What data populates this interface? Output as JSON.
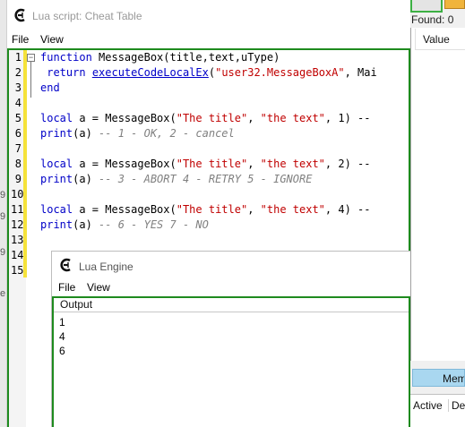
{
  "background": {
    "left_tags": [
      "9",
      "9",
      "9",
      "e"
    ],
    "found_label": "Found: 0",
    "value_header": "Value",
    "memory_view_button": "Mem",
    "cheat_columns": [
      "Active",
      "Des"
    ]
  },
  "lua_window": {
    "title": "Lua script: Cheat Table",
    "menu": [
      "File",
      "View"
    ],
    "line_numbers": [
      "1",
      "2",
      "3",
      "4",
      "5",
      "6",
      "7",
      "8",
      "9",
      "10",
      "11",
      "12",
      "13",
      "14",
      "15"
    ],
    "code": {
      "l1_kw": "function",
      "l1_rest": " MessageBox(title,text,uType)",
      "l2_kw": " return",
      "l2_sp": " ",
      "l2_fn": "executeCodeLocalEx",
      "l2_open": "(",
      "l2_str": "\"user32.MessageBoxA\"",
      "l2_rest": ", Mai",
      "l3_kw": "end",
      "l5_kw": "local",
      "l5_a": " a = MessageBox(",
      "l5_s1": "\"The title\"",
      "l5_c1": ", ",
      "l5_s2": "\"the text\"",
      "l5_tail": ", 1) --",
      "l6_fn": "print",
      "l6_a": "(a) ",
      "l6_cm": "-- 1 - OK, 2 - cancel",
      "l8_kw": "local",
      "l8_a": " a = MessageBox(",
      "l8_s1": "\"The title\"",
      "l8_c1": ", ",
      "l8_s2": "\"the text\"",
      "l8_tail": ", 2) --",
      "l9_fn": "print",
      "l9_a": "(a) ",
      "l9_cm": "-- 3 - ABORT 4 - RETRY 5 - IGNORE",
      "l11_kw": "local",
      "l11_a": " a = MessageBox(",
      "l11_s1": "\"The title\"",
      "l11_c1": ", ",
      "l11_s2": "\"the text\"",
      "l11_tail": ", 4) --",
      "l12_fn": "print",
      "l12_a": "(a) ",
      "l12_cm": "-- 6 - YES 7 - NO"
    }
  },
  "lua_engine": {
    "title": "Lua Engine",
    "menu": [
      "File",
      "View"
    ],
    "output_header": "Output",
    "output_lines": [
      "1",
      "4",
      "6"
    ]
  },
  "colors": {
    "keyword": "#0000c8",
    "string": "#c00000",
    "comment": "#808080",
    "focus_border": "#1e8a1e",
    "gutter_marker": "#f5e23a"
  },
  "icons": [
    "cheat-engine-logo-icon",
    "cheat-engine-logo-icon"
  ]
}
